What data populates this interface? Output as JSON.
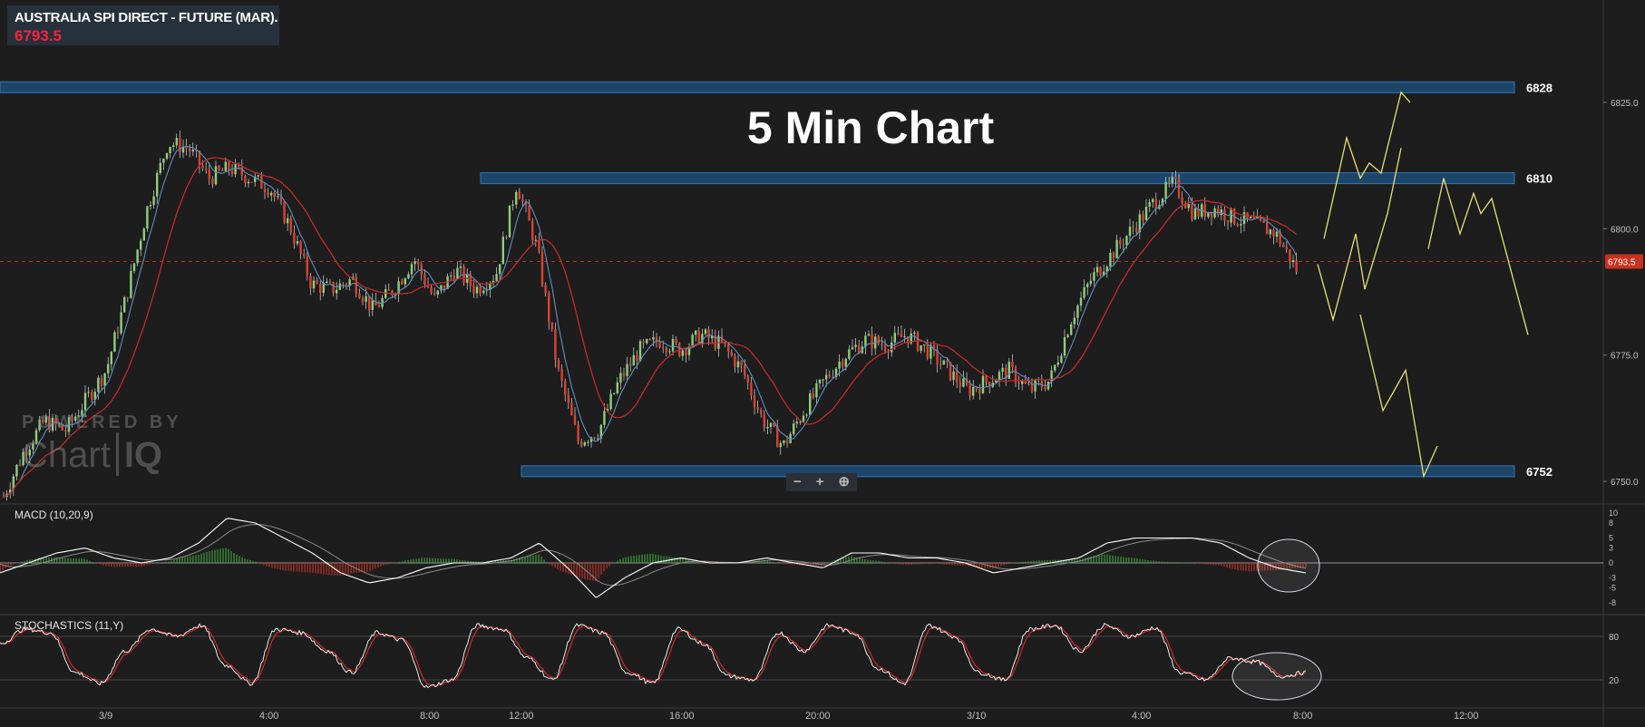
{
  "header": {
    "instrument": "AUSTRALIA SPI DIRECT - FUTURE (MAR).",
    "last_price": "6793.5"
  },
  "headline": "5 Min Chart",
  "watermark": {
    "line1": "POWERED BY",
    "brand_a": "Chart",
    "brand_b": "IQ"
  },
  "zoom_controls": {
    "zoom_out": "−",
    "zoom_in": "+",
    "reset": "⊕"
  },
  "indicators": {
    "macd_label": "MACD (10,20,9)",
    "stoch_label": "STOCHASTICS (11,Y)"
  },
  "colors": {
    "background": "#1d1d1d",
    "candle_up": "#8ecf7a",
    "candle_down": "#d9432f",
    "ma_fast": "#5e8fc2",
    "ma_slow": "#d12a2a",
    "level_box_fill": "#1d4a73",
    "level_box_stroke": "#3b7fbf",
    "projection": "#e8e070",
    "price_marker": "#c8321e"
  },
  "chart_data": {
    "type": "candlestick",
    "title": "5 Min Chart",
    "price_axis": {
      "ticks": [
        "6825.0",
        "6800.0",
        "6775.0",
        "6750.0"
      ],
      "tick_values": [
        6825,
        6800,
        6775,
        6750
      ],
      "ylim": [
        6747,
        6829
      ]
    },
    "time_axis": {
      "ticks": [
        "3/9",
        "4:00",
        "8:00",
        "12:00",
        "16:00",
        "20:00",
        "3/10",
        "4:00",
        "8:00",
        "12:00"
      ]
    },
    "current_price": 6793.5,
    "levels": [
      {
        "label": "6828",
        "value": 6828
      },
      {
        "label": "6810",
        "value": 6810
      },
      {
        "label": "6752",
        "value": 6752
      }
    ],
    "price_path": [
      6747,
      6756,
      6762,
      6760,
      6766,
      6772,
      6787,
      6804,
      6817,
      6816,
      6810,
      6812,
      6810,
      6808,
      6800,
      6789,
      6788,
      6790,
      6784,
      6788,
      6794,
      6786,
      6792,
      6788,
      6791,
      6809,
      6796,
      6772,
      6758,
      6760,
      6770,
      6776,
      6778,
      6776,
      6779,
      6777,
      6772,
      6762,
      6757,
      6764,
      6770,
      6775,
      6778,
      6777,
      6779,
      6776,
      6772,
      6768,
      6770,
      6772,
      6768,
      6770,
      6782,
      6790,
      6795,
      6800,
      6805,
      6809,
      6803,
      6804,
      6802,
      6801,
      6799,
      6792
    ],
    "projection_paths": [
      [
        [
          1460,
          6798
        ],
        [
          1485,
          6818
        ],
        [
          1500,
          6810
        ],
        [
          1510,
          6813
        ],
        [
          1523,
          6811
        ],
        [
          1545,
          6827
        ],
        [
          1555,
          6825
        ]
      ],
      [
        [
          1453,
          6793
        ],
        [
          1470,
          6782
        ],
        [
          1495,
          6799
        ],
        [
          1505,
          6788
        ],
        [
          1530,
          6803
        ],
        [
          1545,
          6816
        ]
      ],
      [
        [
          1500,
          6783
        ],
        [
          1525,
          6764
        ],
        [
          1550,
          6772
        ],
        [
          1570,
          6751
        ],
        [
          1585,
          6757
        ]
      ],
      [
        [
          1575,
          6796
        ],
        [
          1592,
          6810
        ],
        [
          1610,
          6799
        ],
        [
          1625,
          6807
        ],
        [
          1633,
          6803
        ],
        [
          1645,
          6806
        ],
        [
          1685,
          6779
        ]
      ]
    ],
    "macd": {
      "params": "10,20,9",
      "ticks": [
        "10",
        "8",
        "5",
        "3",
        "0",
        "-3",
        "-5",
        "-8"
      ],
      "tick_values": [
        10,
        8,
        5,
        3,
        0,
        -3,
        -5,
        -8
      ],
      "ylim": [
        -10,
        11
      ],
      "macd_path": [
        -2,
        0,
        2,
        3,
        1,
        0,
        1,
        4,
        9,
        8,
        5,
        2,
        -2,
        -4,
        -3,
        -1,
        0,
        0,
        1,
        4,
        -1,
        -7,
        -3,
        0,
        1,
        0,
        0,
        1,
        0,
        -1,
        2,
        2,
        1,
        1,
        0,
        -2,
        -1,
        0,
        1,
        4,
        5,
        5,
        5,
        4,
        1,
        -1,
        -2
      ]
    },
    "stochastics": {
      "params": "11,Y",
      "ticks": [
        "80",
        "20"
      ],
      "tick_values": [
        80,
        20
      ],
      "ylim": [
        0,
        100
      ],
      "path": [
        70,
        90,
        85,
        30,
        15,
        60,
        90,
        80,
        95,
        40,
        15,
        90,
        85,
        60,
        30,
        85,
        75,
        10,
        20,
        95,
        90,
        50,
        20,
        95,
        85,
        30,
        15,
        90,
        70,
        25,
        20,
        85,
        60,
        95,
        85,
        35,
        15,
        95,
        80,
        30,
        20,
        90,
        95,
        60,
        95,
        80,
        92,
        30,
        20,
        50,
        45,
        25,
        30
      ]
    }
  }
}
